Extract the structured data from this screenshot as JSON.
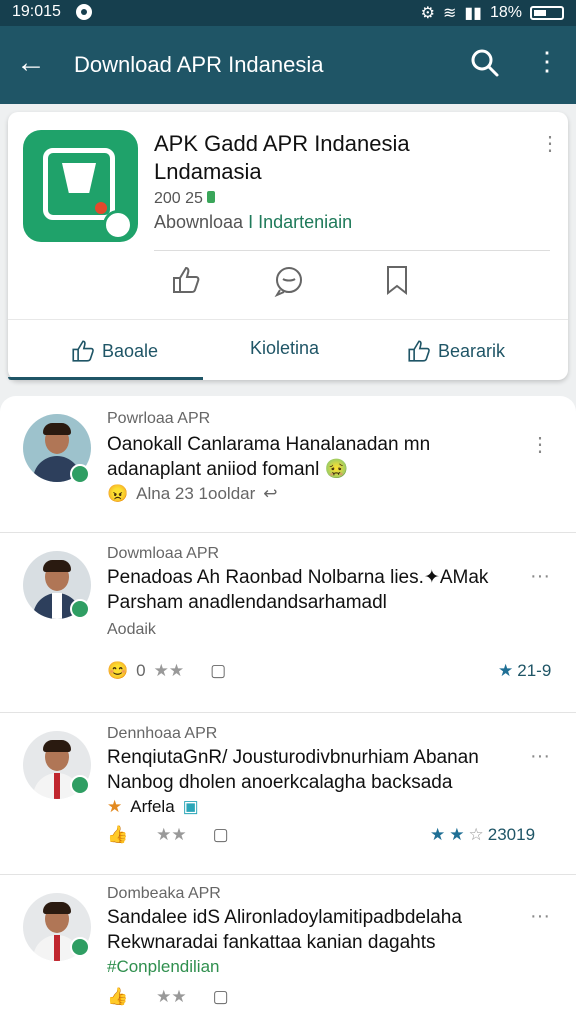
{
  "status_bar": {
    "time": "19:015",
    "battery": "18%"
  },
  "app_bar": {
    "title": "Download APR Indanesia"
  },
  "app_card": {
    "name": "APK Gadd APR Indanesia Lndamasia",
    "size": "200 25",
    "downloads_prefix": "Abownloaa",
    "downloads_highlight": "I Indarteniain",
    "actions": [
      {
        "label": "Baoale",
        "icon": "thumbs-up-icon"
      },
      {
        "label": "Kioletina",
        "icon": ""
      },
      {
        "label": "Beararik",
        "icon": "thumbs-up-icon"
      }
    ]
  },
  "posts": [
    {
      "source": "Powrloaa APR",
      "text": "Oanokall Canlarama Hanalanadan mn adanaplant aniiod fomanl 🤢",
      "meta": "Alna 23 1ooldar"
    },
    {
      "source": "Dowmloaa APR",
      "text": "Penadoas Ah Raonbad Nolbarna lies.✦AMak Parsham anadlendandsarhamadl",
      "sub": "Aodaik",
      "reaction_count": "0",
      "rating": "21-9"
    },
    {
      "source": "Dennhoaa APR",
      "text": "RenqiutaGnR/ Jousturodivbnurhiam Abanan Nanbog dholen anoerkcalagha backsada",
      "tag": "Arfela",
      "rating": "23019"
    },
    {
      "source": "Dombeaka APR",
      "text": "Sandalee idS Alironladoylamitipadbdelaha Rekwnaradai fankattaa kanian dagahts",
      "tag": "#Conplendilian"
    }
  ],
  "colors": {
    "appbar": "#1f5566",
    "status": "#163f4e",
    "accent": "#1f5566",
    "icon_green": "#1fa26a"
  }
}
